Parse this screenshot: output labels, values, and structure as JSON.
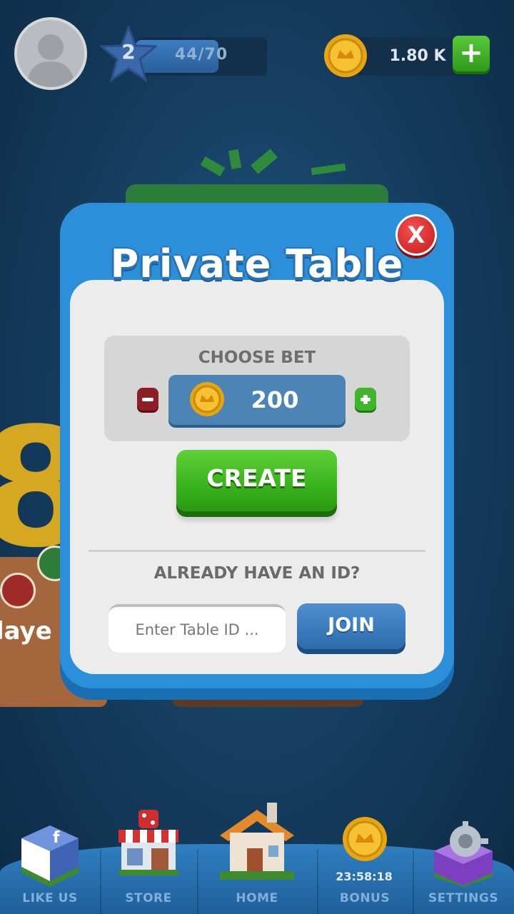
{
  "header": {
    "level": "2",
    "xp": "44/70",
    "xp_progress": 0.63,
    "coins": "1.80 K"
  },
  "dialog": {
    "title": "Private Table",
    "close_label": "X",
    "bet": {
      "label": "CHOOSE BET",
      "value": "200"
    },
    "create_label": "CREATE",
    "already_label": "ALREADY HAVE AN ID?",
    "table_id_placeholder": "Enter Table ID ...",
    "join_label": "JOIN"
  },
  "background": {
    "big_digit": "8",
    "player_text": "laye"
  },
  "nav": {
    "items": [
      {
        "label": "LIKE US",
        "icon": "facebook-cube-icon"
      },
      {
        "label": "STORE",
        "icon": "store-icon"
      },
      {
        "label": "HOME",
        "icon": "house-icon"
      },
      {
        "label": "BONUS",
        "icon": "coin-icon"
      },
      {
        "label": "SETTINGS",
        "icon": "gear-icon"
      }
    ],
    "bonus_timer": "23:58:18"
  },
  "colors": {
    "background": "#163f62",
    "dialog_blue": "#2b8fd9",
    "create_green": "#38b21a",
    "join_blue": "#2c6cab",
    "close_red": "#c51b1b",
    "coin_gold": "#f2b51c"
  }
}
